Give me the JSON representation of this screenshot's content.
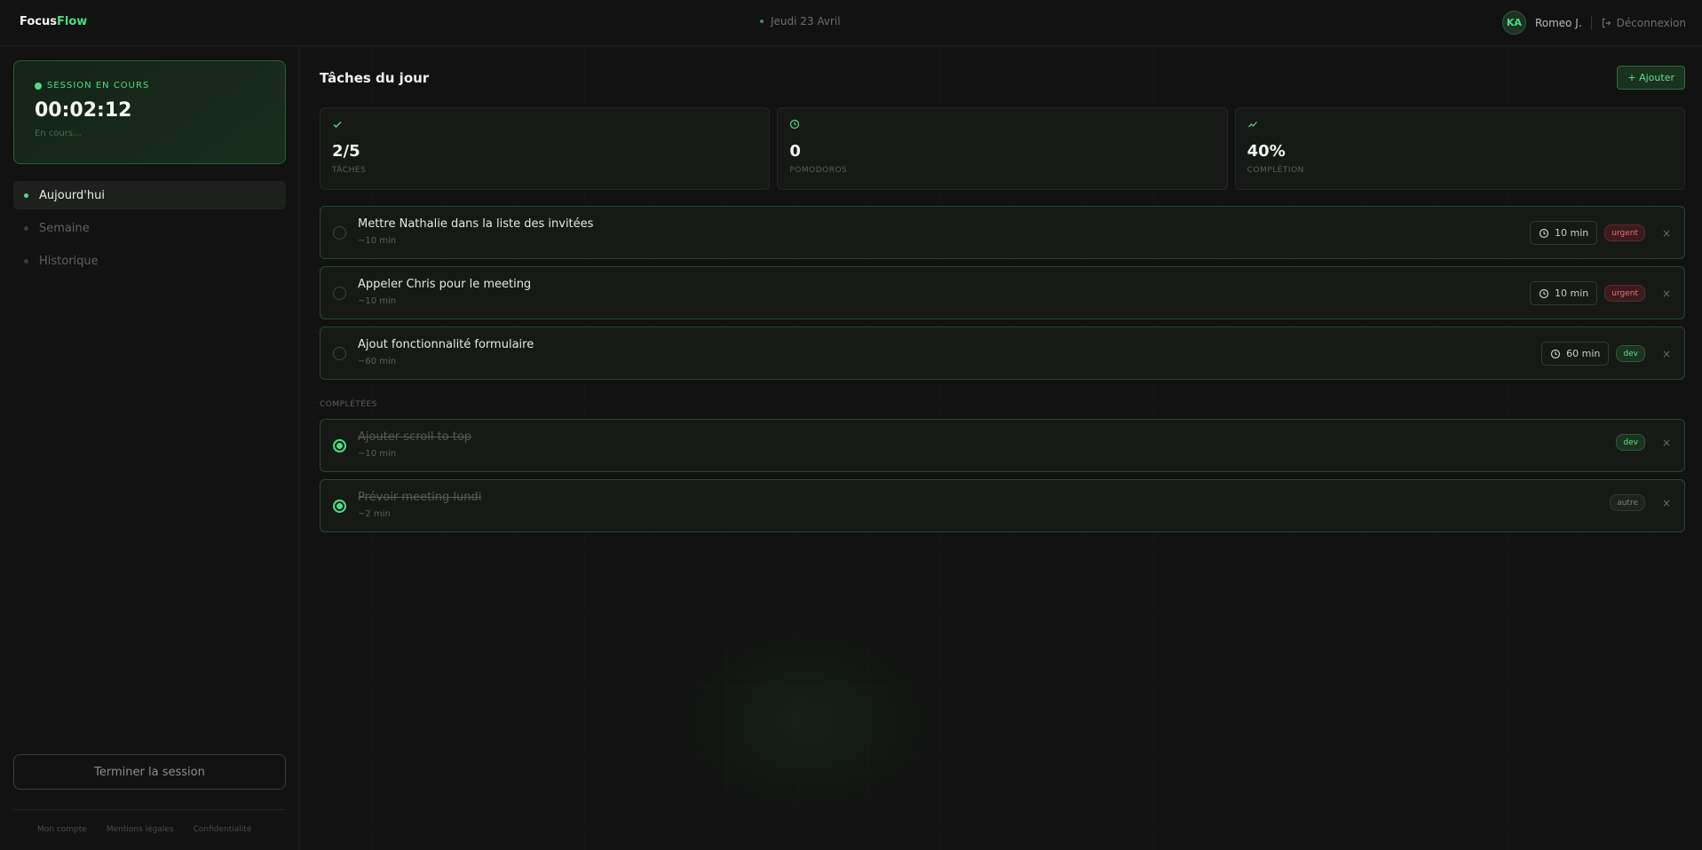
{
  "header": {
    "brand_part1": "Focus",
    "brand_part2": "Flow",
    "date": "Jeudi 23 Avril",
    "user_initials": "KA",
    "user_name": "Romeo J.",
    "logout_label": "Déconnexion"
  },
  "session": {
    "label": "SESSION EN COURS",
    "timer": "00:02:12",
    "status": "En cours..."
  },
  "nav": {
    "items": [
      {
        "label": "Aujourd'hui"
      },
      {
        "label": "Semaine"
      },
      {
        "label": "Historique"
      }
    ]
  },
  "sidebar_footer": {
    "end_session_label": "Terminer la session",
    "links": [
      "Mon compte",
      "Mentions légales",
      "Confidentialité"
    ]
  },
  "main": {
    "title": "Tâches du jour",
    "add_label": "+ Ajouter",
    "stats": [
      {
        "icon": "check-icon",
        "value": "2/5",
        "label": "TÂCHES"
      },
      {
        "icon": "clock-icon",
        "value": "0",
        "label": "POMODOROS"
      },
      {
        "icon": "trend-icon",
        "value": "40%",
        "label": "COMPLÉTION"
      }
    ],
    "tasks": [
      {
        "name": "Mettre Nathalie dans la liste des invitées",
        "estimate": "~10 min",
        "timer": "10 min",
        "tag": "urgent"
      },
      {
        "name": "Appeler Chris pour le meeting",
        "estimate": "~10 min",
        "timer": "10 min",
        "tag": "urgent"
      },
      {
        "name": "Ajout fonctionnalité formulaire",
        "estimate": "~60 min",
        "timer": "60 min",
        "tag": "dev"
      }
    ],
    "completed_label": "COMPLÉTÉES",
    "completed": [
      {
        "name": "Ajouter scroll to top",
        "estimate": "~10 min",
        "tag": "dev"
      },
      {
        "name": "Prévoir meeting lundi",
        "estimate": "~2 min",
        "tag": "autre"
      }
    ],
    "close_glyph": "×"
  },
  "colors": {
    "accent": "#4ade80",
    "background": "#111211",
    "urgent": "#ef6b76"
  }
}
